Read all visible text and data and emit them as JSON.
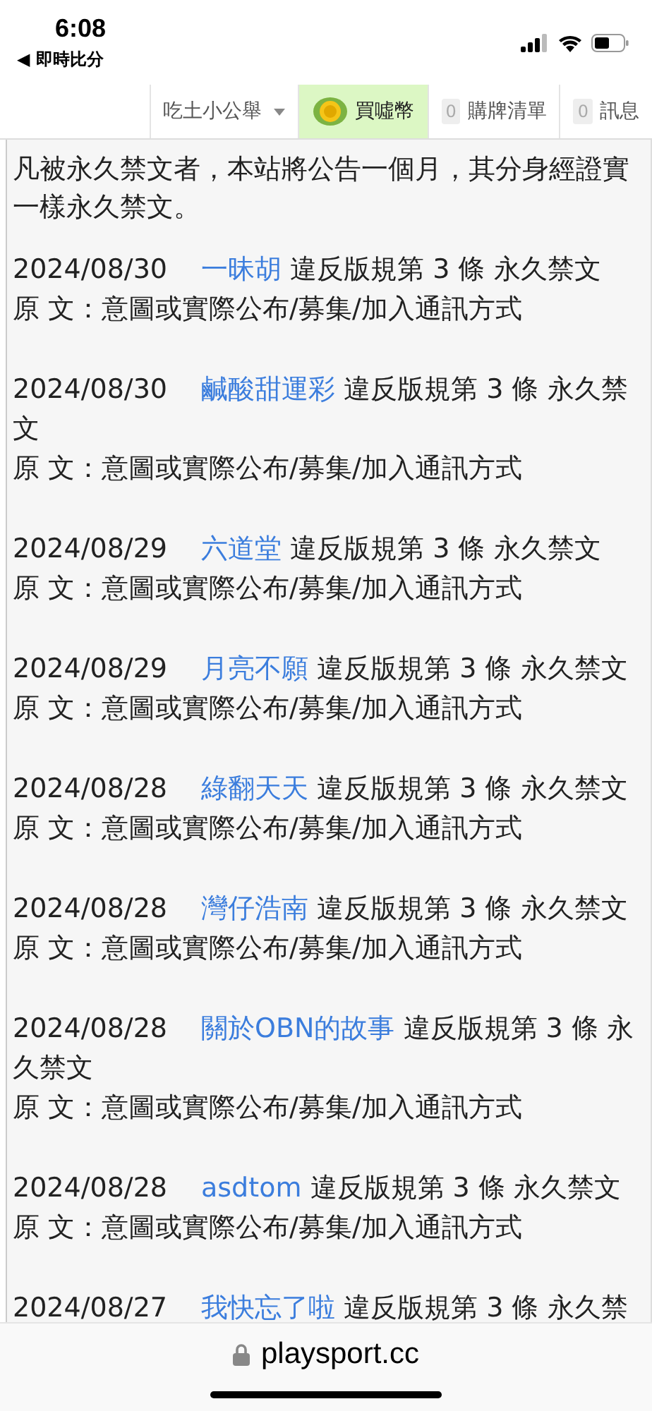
{
  "status_bar": {
    "time": "6:08",
    "back_label": "◀ 即時比分"
  },
  "nav": [
    {
      "kind": "dropdown",
      "label": "吃土小公舉",
      "highlighted": false
    },
    {
      "kind": "coin",
      "label": "買噓幣",
      "highlighted": true
    },
    {
      "kind": "count",
      "count": "0",
      "label": "購牌清單",
      "highlighted": false
    },
    {
      "kind": "count",
      "count": "0",
      "label": "訊息",
      "highlighted": false
    }
  ],
  "notice": "凡被永久禁文者，本站將公告一個月，其分身經證實一樣永久禁文。",
  "entries": [
    {
      "date": "2024/08/30",
      "user": "一昧胡",
      "rule": "違反版規第 3 條 永久禁文",
      "original": "原 文：意圖或實際公布/募集/加入通訊方式"
    },
    {
      "date": "2024/08/30",
      "user": "鹹酸甜運彩",
      "rule": "違反版規第 3 條 永久禁文",
      "original": "原 文：意圖或實際公布/募集/加入通訊方式"
    },
    {
      "date": "2024/08/29",
      "user": "六道堂",
      "rule": "違反版規第 3 條 永久禁文",
      "original": "原 文：意圖或實際公布/募集/加入通訊方式"
    },
    {
      "date": "2024/08/29",
      "user": "月亮不願",
      "rule": "違反版規第 3 條 永久禁文",
      "original": "原 文：意圖或實際公布/募集/加入通訊方式"
    },
    {
      "date": "2024/08/28",
      "user": "綠翻天天",
      "rule": "違反版規第 3 條 永久禁文",
      "original": "原 文：意圖或實際公布/募集/加入通訊方式"
    },
    {
      "date": "2024/08/28",
      "user": "灣仔浩南",
      "rule": "違反版規第 3 條 永久禁文",
      "original": "原 文：意圖或實際公布/募集/加入通訊方式"
    },
    {
      "date": "2024/08/28",
      "user": "關於OBN的故事",
      "rule": "違反版規第 3 條 永久禁文",
      "original": "原 文：意圖或實際公布/募集/加入通訊方式"
    },
    {
      "date": "2024/08/28",
      "user": "asdtom",
      "rule": "違反版規第 3 條 永久禁文",
      "original": "原 文：意圖或實際公布/募集/加入通訊方式"
    },
    {
      "date": "2024/08/27",
      "user": "我快忘了啦",
      "rule": "違反版規第 3 條 永久禁"
    }
  ],
  "address_bar": {
    "url": "playsport.cc"
  }
}
